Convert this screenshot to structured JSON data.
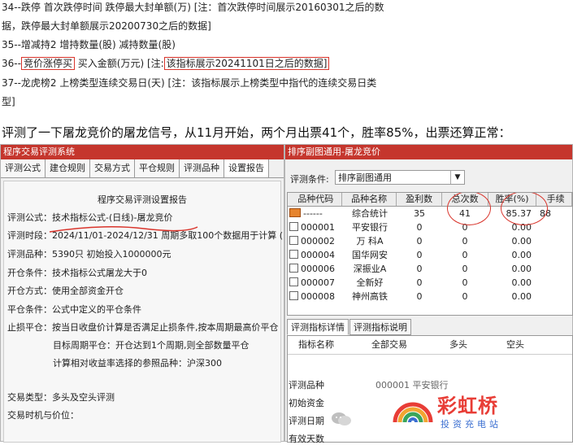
{
  "top_lines": {
    "l34": "34--跌停 首次跌停时间 跌停最大封单额(万) [注：首次跌停时间展示20160301之后的数",
    "l34b": "据，跌停最大封单额展示20200730之后的数据]",
    "l35": "35--增减持2 增持数量(股) 减持数量(股)",
    "l36_prefix": "36--",
    "l36_box": "竞价涨停买",
    "l36_mid": " 买入金额(万元) [注:",
    "l36_box2": "该指标展示20241101日之后的数据]",
    "l37": "37--龙虎榜2 上榜类型连续交易日(天) [注：该指标展示上榜类型中指代的连续交易日类",
    "l37b": "型]"
  },
  "caption": "评测了一下屠龙竞价的屠龙信号，从11月开始，两个月出票41个，胜率85%，出票还算正常：",
  "left_window": {
    "title": "程序交易评测系统",
    "tabs": [
      "评测公式",
      "建仓规则",
      "交易方式",
      "平仓规则",
      "评测品种",
      "设置报告"
    ],
    "report_title": "程序交易评测设置报告",
    "lines": [
      "评测公式：技术指标公式-(日线)-屠龙竞价",
      "评测时段：2024/11/01-2024/12/31 周期多取100个数据用于计算 (",
      "评测品种：5390只 初始投入1000000元",
      "开仓条件：技术指标公式屠龙大于0",
      "开仓方式：使用全部资金开仓",
      "平仓条件：公式中定义的平仓条件",
      "止损平仓：按当日收盘价计算是否满足止损条件,按本周期最高价平仓",
      "目标周期平仓：开仓达到1个周期,则全部数量平仓",
      "计算相对收益率选择的参照品种：沪深300",
      "交易类型：多头及空头评测",
      "交易时机与价位："
    ]
  },
  "right_window": {
    "title": "排序副图通用-屠龙竞价",
    "cond_label": "评测条件:",
    "cond_value": "排序副图通用",
    "columns": [
      "品种代码",
      "品种名称",
      "盈利数",
      "总次数",
      "胜率(%)",
      "手续"
    ],
    "rows": [
      {
        "code": "------",
        "name": "综合统计",
        "win": "35",
        "total": "41",
        "rate": "85.37",
        "fee": "88"
      },
      {
        "code": "000001",
        "name": "平安银行",
        "win": "0",
        "total": "0",
        "rate": "0.00",
        "fee": ""
      },
      {
        "code": "000002",
        "name": "万 科A",
        "win": "0",
        "total": "0",
        "rate": "0.00",
        "fee": ""
      },
      {
        "code": "000004",
        "name": "国华网安",
        "win": "0",
        "total": "0",
        "rate": "0.00",
        "fee": ""
      },
      {
        "code": "000006",
        "name": "深振业A",
        "win": "0",
        "total": "0",
        "rate": "0.00",
        "fee": ""
      },
      {
        "code": "000007",
        "name": "全新好",
        "win": "0",
        "total": "0",
        "rate": "0.00",
        "fee": ""
      },
      {
        "code": "000008",
        "name": "神州高铁",
        "win": "0",
        "total": "0",
        "rate": "0.00",
        "fee": ""
      }
    ],
    "bottom_tabs": [
      "评测指标详情",
      "评测指标说明"
    ],
    "detail_head": [
      "指标名称",
      "全部交易",
      "多头",
      "空头"
    ],
    "detail_rows": [
      "评测品种",
      "初始资金",
      "评测日期",
      "有效天数"
    ],
    "detail_value": "000001 平安银行"
  },
  "watermark": {
    "main": "彩虹桥",
    "sub": "投资充电站"
  },
  "colors": {
    "accent": "#c5362d",
    "highlight": "#d9342b"
  }
}
